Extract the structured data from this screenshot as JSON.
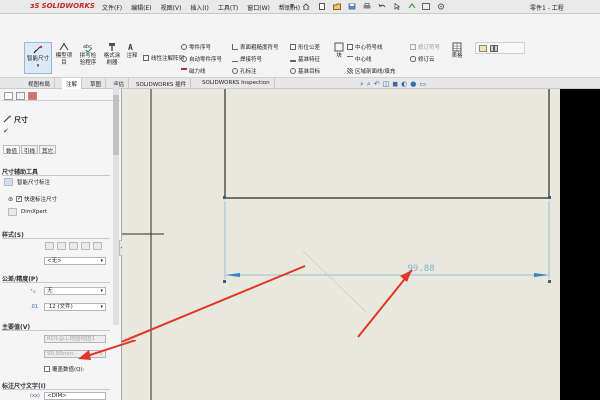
{
  "app": {
    "brand": "SOLIDWORKS",
    "title": "零件1 - 工程"
  },
  "menu": [
    "文件(F)",
    "编辑(E)",
    "视图(V)",
    "插入(I)",
    "工具(T)",
    "窗口(W)",
    "帮助(H)"
  ],
  "commands": {
    "smart_dimension": "智能尺寸",
    "model_items": "模型项目",
    "spell_check_line1": "拼写检",
    "spell_check_line2": "验程序",
    "format_painter_line1": "格式涂",
    "format_painter_line2": "刷器",
    "note": "注释",
    "linear_note_pattern": "线性注解阵列",
    "balloon": "零件序号",
    "auto_balloon": "自动零件序号",
    "magnetic_line": "磁力线",
    "surface_finish": "表面粗糙度符号",
    "weld_symbol": "焊接符号",
    "hole_callout": "孔标注",
    "geometric_tolerance": "形位公差",
    "datum_feature": "基准特征",
    "datum_target": "基准目标",
    "block": "块",
    "center_mark": "中心符号线",
    "centerline": "中心线",
    "area_hatch": "区域剖面线/填充",
    "revision_symbol": "修订符号",
    "revision_cloud": "修订云",
    "tables": "表格"
  },
  "tabs": [
    "视图布局",
    "注解",
    "草图",
    "评估",
    "SOLIDWORKS 插件",
    "SOLIDWORKS Inspection"
  ],
  "panel": {
    "title": "尺寸",
    "subtabs": [
      "数值",
      "引线",
      "其它"
    ],
    "dim_assist_title": "尺寸辅助工具",
    "smart_dim_label": "智能尺寸标注",
    "quick_dim_label": "快速标注尺寸",
    "dimxpert_label": "DimXpert",
    "style_title": "样式(S)",
    "style_value": "<无>",
    "tolerance_title": "公差/精度(P)",
    "tolerance_value": "无",
    "precision_value": ".12 (文件)",
    "primary_value_title": "主要值(V)",
    "primary_ref": "RD1@工程图视图1",
    "primary_value": "99.88mm",
    "override_label": "覆盖数值(Q):",
    "dim_text_title": "标注尺寸文字(I)",
    "dim_text_value": "<DIM>"
  },
  "drawing": {
    "dimension_text": "99.88"
  },
  "colors": {
    "dimension": "#7fb0d8",
    "arrow_annotation": "#e0372b",
    "canvas": "#e9e8dc"
  }
}
